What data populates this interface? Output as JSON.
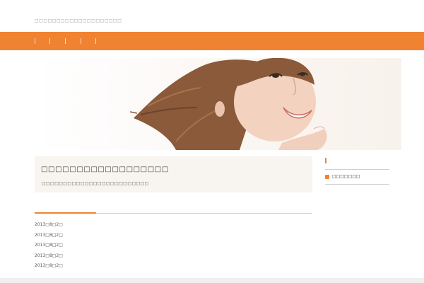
{
  "header": {
    "site_description": "□□□□□□□□□□□□□□□□□□□□"
  },
  "nav": {
    "items": [
      "",
      "",
      "",
      "",
      ""
    ]
  },
  "featured_post": {
    "title": "□□□□□□□□□□□□□□□□□□",
    "excerpt": "□□□□□□□□□□□□□□□□□□□□□□□□□"
  },
  "sidebar": {
    "link_label": "□□□□□□□"
  },
  "archive": {
    "items": [
      "2013□8□2□",
      "2013□8□2□",
      "2013□8□2□",
      "2013□8□2□",
      "2013□8□2□"
    ]
  },
  "colors": {
    "accent": "#f08331",
    "nav_background": "#f08331",
    "post_box_background": "#f8f4ef",
    "rule": "#cfcfcf"
  },
  "icons": {
    "sidebar_bullet": "square-bullet-icon"
  }
}
